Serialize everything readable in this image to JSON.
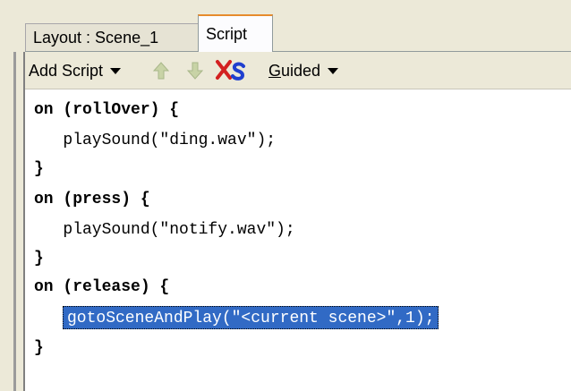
{
  "tabs": [
    {
      "label": "Layout : Scene_1"
    },
    {
      "label": "Script"
    }
  ],
  "toolbar": {
    "add_script": "Add Script",
    "guided_g": "G",
    "guided_rest": "uided",
    "icons": [
      "move-up-arrow-icon",
      "move-down-arrow-icon",
      "delete-script-icon"
    ]
  },
  "code": [
    "on (rollOver) {",
    "   playSound(\"ding.wav\");",
    "}",
    "on (press) {",
    "   playSound(\"notify.wav\");",
    "}",
    "on (release) {",
    "gotoSceneAndPlay(\"<current scene>\",1);",
    "}"
  ],
  "colors": {
    "selection": "#316ac5",
    "active_tab_accent": "#e68b2c",
    "up_arrow": "#c8d3a6",
    "delete_x": "#d32020",
    "delete_s": "#1f3fcf"
  }
}
